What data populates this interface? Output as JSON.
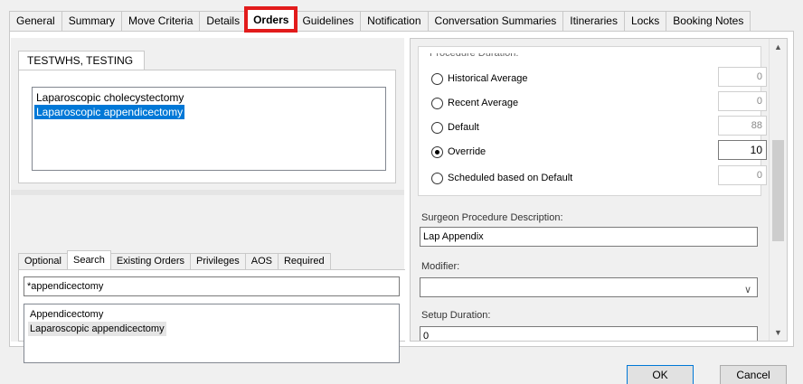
{
  "tabs": [
    "General",
    "Summary",
    "Move Criteria",
    "Details",
    "Orders",
    "Guidelines",
    "Notification",
    "Conversation Summaries",
    "Itineraries",
    "Locks",
    "Booking Notes"
  ],
  "active_tab": "Orders",
  "highlight_color": "#e21b1b",
  "patient": {
    "tab_label": "TESTWHS, TESTING",
    "procedures": [
      "Laparoscopic cholecystectomy",
      "Laparoscopic appendicectomy"
    ],
    "selected_procedure": "Laparoscopic appendicectomy"
  },
  "search_panel": {
    "tabs": [
      "Optional",
      "Search",
      "Existing Orders",
      "Privileges",
      "AOS",
      "Required"
    ],
    "active_tab": "Search",
    "query": "*appendicectomy",
    "results": [
      "Appendicectomy",
      "Laparoscopic appendicectomy"
    ]
  },
  "procedure_duration": {
    "caption": "Procedure Duration:",
    "options": [
      {
        "label": "Historical Average",
        "value": "0",
        "checked": false
      },
      {
        "label": "Recent Average",
        "value": "0",
        "checked": false
      },
      {
        "label": "Default",
        "value": "88",
        "checked": false
      },
      {
        "label": "Override",
        "value": "10",
        "checked": true
      },
      {
        "label": "Scheduled based on Default",
        "value": "0",
        "checked": false
      }
    ]
  },
  "surgeon_description": {
    "label": "Surgeon Procedure Description:",
    "value": "Lap Appendix"
  },
  "modifier": {
    "label": "Modifier:",
    "value": ""
  },
  "setup_duration": {
    "label": "Setup Duration:",
    "value": "0"
  },
  "buttons": {
    "ok": "OK",
    "cancel": "Cancel"
  },
  "selection_color": "#0078d7"
}
